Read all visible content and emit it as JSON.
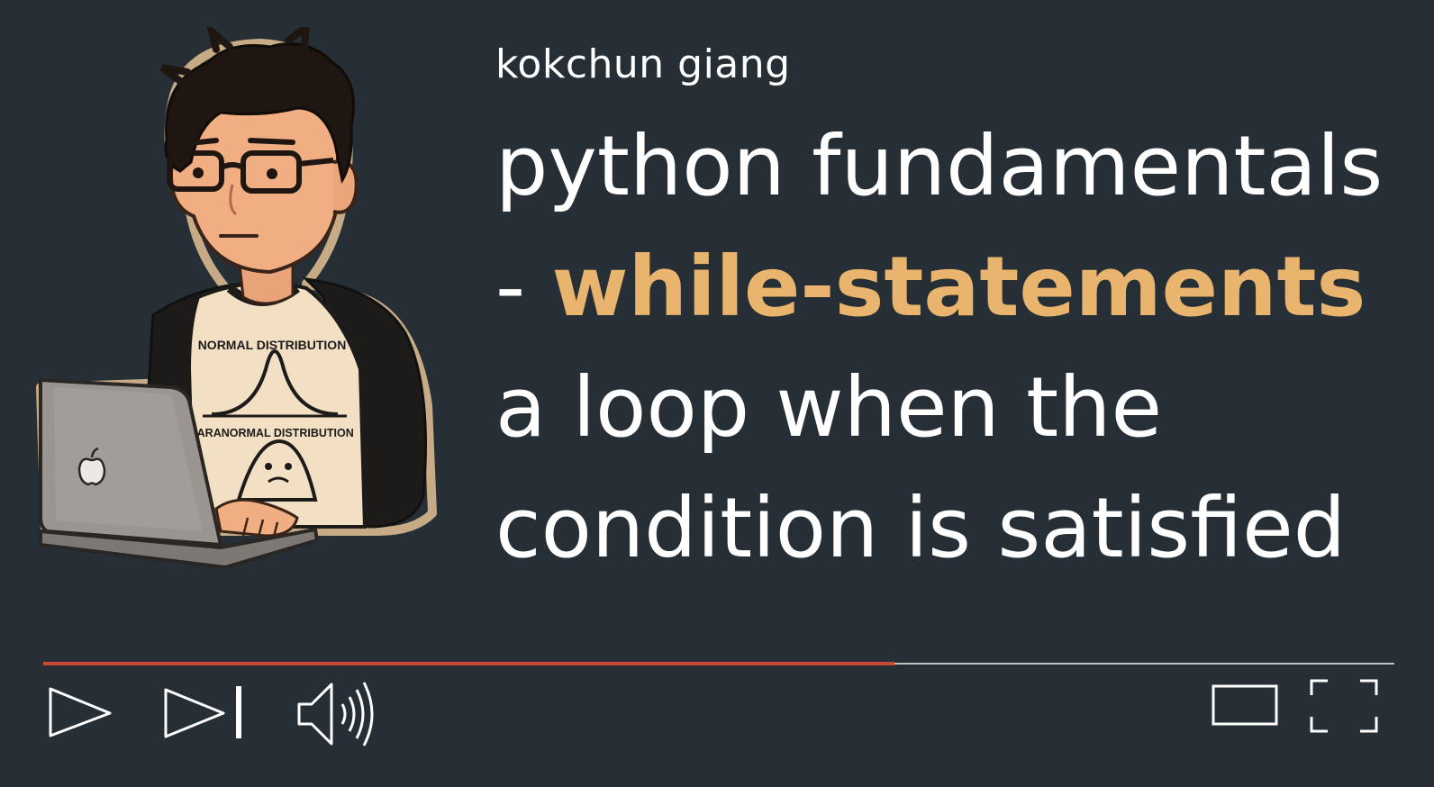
{
  "video": {
    "channel_name": "kokchun giang",
    "title_lead": "python fundamentals - ",
    "title_highlight": "while-statements",
    "title_tail": " a loop when the condition is satisfied",
    "highlight_color": "#e9b46e",
    "progress_fraction": 0.63
  },
  "illustration": {
    "shirt_text_top": "NORMAL DISTRIBUTION",
    "shirt_text_bottom": "PARANORMAL DISTRIBUTION"
  },
  "controls": {
    "left": [
      "play-icon",
      "next-icon",
      "volume-icon"
    ],
    "right": [
      "theater-mode-icon",
      "fullscreen-icon"
    ]
  },
  "colors": {
    "background": "#272f36",
    "accent": "#e9b46e",
    "progress": "#c94a33"
  }
}
